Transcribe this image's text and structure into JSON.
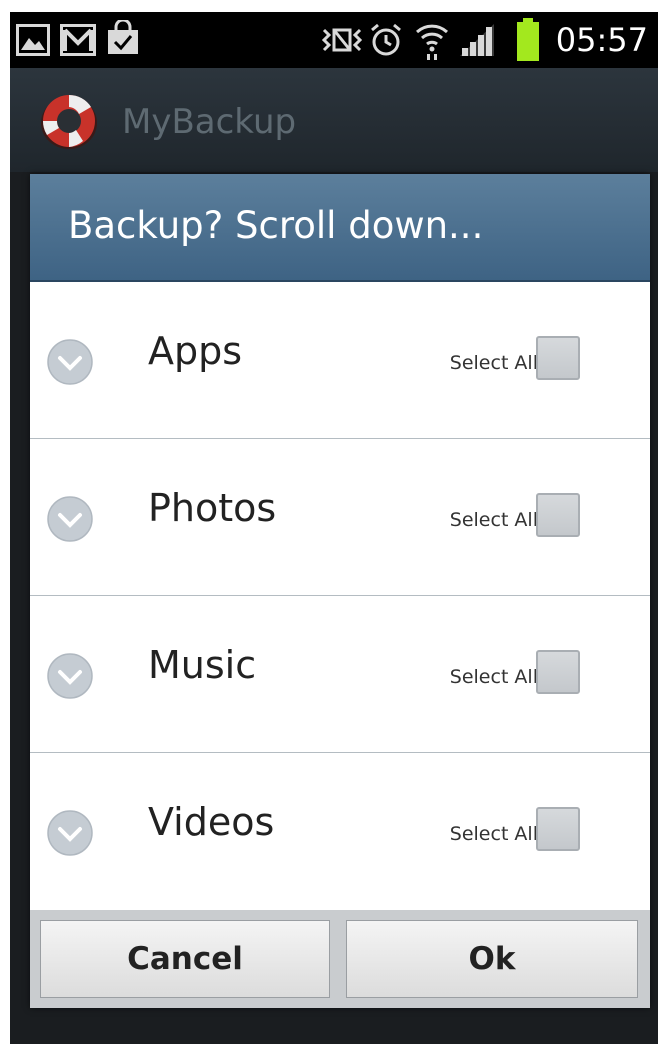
{
  "status_bar": {
    "time": "05:57",
    "icons": [
      "gallery-icon",
      "gmail-icon",
      "shopping-bag-icon",
      "nfc-icon",
      "alarm-icon",
      "wifi-icon",
      "signal-icon",
      "battery-icon"
    ],
    "battery_color": "#a3e81e"
  },
  "action_bar": {
    "title": "MyBackup",
    "logo_icon": "lifebuoy-icon"
  },
  "dialog": {
    "title": "Backup? Scroll down...",
    "rows": [
      {
        "label": "Apps",
        "select_all": "Select All",
        "checked": false
      },
      {
        "label": "Photos",
        "select_all": "Select All",
        "checked": false
      },
      {
        "label": "Music",
        "select_all": "Select All",
        "checked": false
      },
      {
        "label": "Videos",
        "select_all": "Select All",
        "checked": false
      }
    ],
    "buttons": {
      "cancel": "Cancel",
      "ok": "Ok"
    }
  },
  "colors": {
    "dialog_title_bg": "#4d718f",
    "accent": "#3e6384"
  }
}
